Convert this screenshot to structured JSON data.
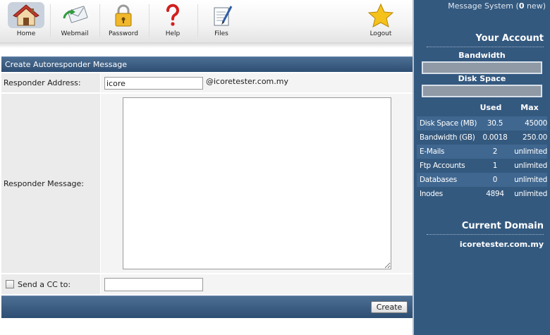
{
  "toolbar": {
    "items": [
      {
        "label": "Home",
        "icon": "home-icon"
      },
      {
        "label": "Webmail",
        "icon": "webmail-icon"
      },
      {
        "label": "Password",
        "icon": "lock-icon"
      },
      {
        "label": "Help",
        "icon": "help-icon"
      },
      {
        "label": "Files",
        "icon": "files-icon"
      },
      {
        "label": "Logout",
        "icon": "star-icon"
      }
    ]
  },
  "sidebar": {
    "message_system": {
      "prefix": "Message System (",
      "count": "0",
      "suffix": " new)"
    },
    "your_account": "Your Account",
    "bandwidth_label": "Bandwidth",
    "disk_space_label": "Disk Space",
    "bandwidth_bar_fraction": 0.0,
    "disk_space_bar_fraction": 0.0,
    "stats_headers": {
      "used": "Used",
      "max": "Max"
    },
    "stats": [
      {
        "name": "Disk Space (MB)",
        "used": "30.5",
        "max": "45000"
      },
      {
        "name": "Bandwidth (GB)",
        "used": "0.0018",
        "max": "250.00"
      },
      {
        "name": "E-Mails",
        "used": "2",
        "max": "unlimited"
      },
      {
        "name": "Ftp Accounts",
        "used": "1",
        "max": "unlimited"
      },
      {
        "name": "Databases",
        "used": "0",
        "max": "unlimited"
      },
      {
        "name": "Inodes",
        "used": "4894",
        "max": "unlimited"
      }
    ],
    "current_domain_title": "Current Domain",
    "current_domain": "icoretester.com.my"
  },
  "form": {
    "title": "Create Autoresponder Message",
    "responder_address_label": "Responder Address:",
    "responder_address_value": "icore",
    "domain_suffix": "@icoretester.com.my",
    "responder_message_label": "Responder Message:",
    "responder_message_value": "",
    "cc_label": "Send a CC to:",
    "cc_value": "",
    "submit_label": "Create"
  },
  "colors": {
    "sidebar_bg": "#34597f",
    "panel_header": "#3d5f85",
    "home_highlight": "#c9d2dc"
  }
}
